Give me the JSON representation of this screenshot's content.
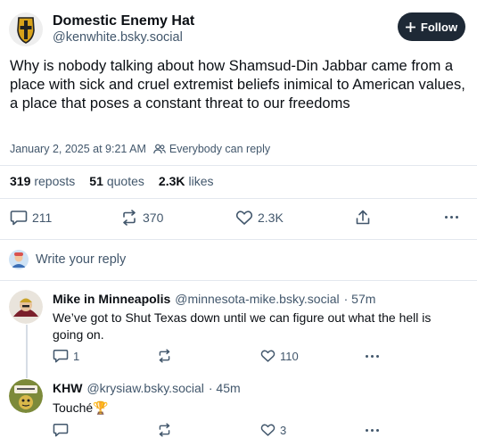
{
  "post": {
    "display_name": "Domestic Enemy Hat",
    "handle": "@kenwhite.bsky.social",
    "follow_label": "Follow",
    "text": "Why is nobody talking about how Shamsud-Din Jabbar came from a place with sick and cruel extremist beliefs inimical to American values, a place that poses a constant threat to our freedoms",
    "timestamp": "January 2, 2025 at 9:21 AM",
    "reply_setting": "Everybody can reply",
    "stats": {
      "reposts_count": "319",
      "reposts_label": "reposts",
      "quotes_count": "51",
      "quotes_label": "quotes",
      "likes_count": "2.3K",
      "likes_label": "likes"
    },
    "actions": {
      "replies": "211",
      "reposts": "370",
      "likes": "2.3K"
    }
  },
  "compose": {
    "placeholder": "Write your reply"
  },
  "replies": [
    {
      "display_name": "Mike in Minneapolis",
      "handle": "@minnesota-mike.bsky.social",
      "age": "· 57m",
      "text": "We’ve got to Shut Texas down until we can figure out what the hell is going on.",
      "reply_count": "1",
      "repost_count": "",
      "like_count": "110"
    },
    {
      "display_name": "KHW",
      "handle": "@krysiaw.bsky.social",
      "age": "· 45m",
      "text": "Touché🏆",
      "reply_count": "",
      "repost_count": "",
      "like_count": "3"
    }
  ],
  "colors": {
    "accent": "#1083fe",
    "button_dark": "#1e2936",
    "muted": "#42576c",
    "divider": "#e3e8ee"
  },
  "icons": [
    "shield-cross-avatar",
    "plus-icon",
    "people-icon",
    "comment-icon",
    "repost-icon",
    "heart-icon",
    "share-icon",
    "more-icon"
  ]
}
